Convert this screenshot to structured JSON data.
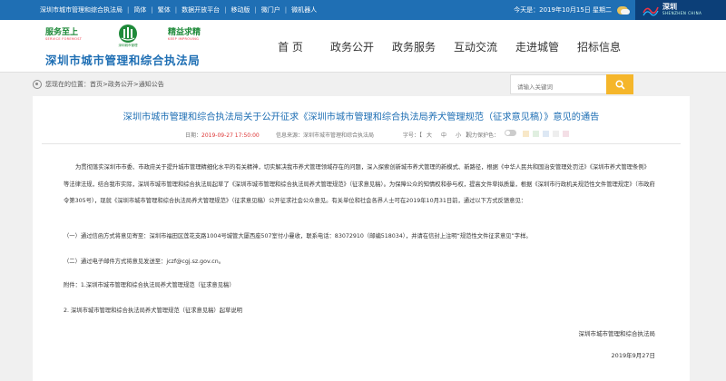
{
  "topbar": {
    "site_name": "深圳市城市管理和综合执法局",
    "links": [
      "简体",
      "繁体",
      "数据开放平台",
      "移动版",
      "微门户",
      "微机器人"
    ],
    "date_text": "今天是：2019年10月15日  星期二",
    "city_logo_text": "深圳",
    "city_logo_en": "SHENZHEN CHINA"
  },
  "brand": {
    "slogan_left": "服务至上",
    "slogan_left_en": "SERVICE FOREMOST",
    "slogan_right": "精益求精",
    "slogan_right_en": "KEEP IMPROVING",
    "emblem_text": "深圳城市管理",
    "name": "深圳市城市管理和综合执法局"
  },
  "nav": [
    "首 页",
    "政务公开",
    "政务服务",
    "互动交流",
    "走进城管",
    "招标信息"
  ],
  "breadcrumb": "您现在的位置：首页>政务公开>通知公告",
  "search": {
    "placeholder": "请输入关键词"
  },
  "article": {
    "title": "深圳市城市管理和综合执法局关于公开征求《深圳市城市管理和综合执法局养犬管理规范（征求意见稿）》意见的通告",
    "date_label": "日期：",
    "date_value": "2019-09-27 17:50:00",
    "source": "信息来源：深圳市城市管理和综合执法局",
    "font_label": "字号：",
    "font_sizes": [
      "大",
      "中",
      "小"
    ],
    "vision_label": "视力保护色：",
    "paragraph1": "为贯彻落实深圳市市委、市政府关于提升城市管理精细化水平的有关精神，切实解决我市养犬管理领域存在的问题，深入探索创新城市养犬管理的新模式、新路径，根据《中华人民共和国治安管理处罚法》《深圳市养犬管理条例》等法律法规，结合我市实际，深圳市城市管理和综合执法局起草了《深圳市城市管理和综合执法局养犬管理规范》（征求意见稿）。为保障公众的知情权和参与权，提高文件草拟质量，根据《深圳市行政机关规范性文件管理规定》（市政府令第305号），现就《深圳市城市管理和综合执法局养犬管理规范》（征求意见稿）公开征求社会公众意见。有关单位和社会各界人士可在2019年10月31日前，通过以下方式反馈意见：",
    "paragraph2": "（一）通过信函方式将意见寄至：深圳市福田区莲花支路1004号城管大厦西座507室付小曼收，联系电话：83072910（邮编518034），并请在信封上注明“规范性文件征求意见”字样。",
    "paragraph3": "（二）通过电子邮件方式将意见发送至：jczf@cgj.sz.gov.cn。",
    "paragraph4": "附件：1.深圳市城市管理和综合执法局养犬管理规范（征求意见稿）",
    "paragraph5": "2. 深圳市城市管理和综合执法局养犬管理规范（征求意见稿）起草说明",
    "signature": "深圳市城市管理和综合执法局",
    "sign_date": "2019年9月27日"
  },
  "colors": {
    "accent": "#1f6fb4",
    "green": "#1f8a3a",
    "search_button": "#f5b62b",
    "date_red": "#d33"
  }
}
